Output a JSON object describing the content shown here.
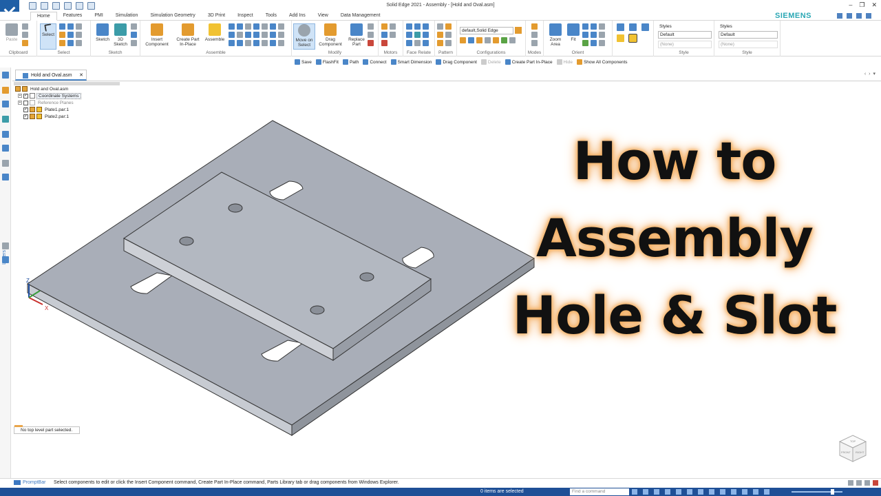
{
  "window": {
    "title": "Solid Edge 2021 - Assembly - [Hold and Oval.asm]",
    "controls": [
      "–",
      "❐",
      "✕"
    ]
  },
  "brand": "SIEMENS",
  "tabs": [
    "Home",
    "Features",
    "PMI",
    "Simulation",
    "Simulation Geometry",
    "3D Print",
    "Inspect",
    "Tools",
    "Add Ins",
    "View",
    "Data Management"
  ],
  "active_tab": "Home",
  "ribbon": {
    "clipboard": {
      "paste": "Paste",
      "label": "Clipboard"
    },
    "select": {
      "select": "Select",
      "label": "Select"
    },
    "sketch": {
      "sketch": "Sketch",
      "sketch3d": "3D Sketch",
      "label": "Sketch"
    },
    "assemble": {
      "insert": "Insert Component",
      "create": "Create Part In-Place",
      "assemble": "Assemble",
      "label": "Assemble"
    },
    "modify": {
      "move": "Move on Select",
      "drag": "Drag Component",
      "replace": "Replace Part",
      "label": "Modify"
    },
    "motors": {
      "label": "Motors"
    },
    "face_relate": {
      "label": "Face Relate"
    },
    "pattern": {
      "label": "Pattern"
    },
    "configurations": {
      "value": "default,Solid Edge",
      "label": "Configurations"
    },
    "modes": {
      "label": "Modes"
    },
    "orient": {
      "zoom": "Zoom Area",
      "fit": "Fit",
      "label": "Orient"
    },
    "style1": {
      "title": "Styles",
      "value": "Default",
      "sub": "(None)",
      "label": "Style"
    },
    "style2": {
      "title": "Styles",
      "value": "Default",
      "sub": "(None)",
      "label": "Style"
    }
  },
  "command_bar": [
    {
      "label": "Save",
      "enabled": true
    },
    {
      "label": "FlashFit",
      "enabled": true
    },
    {
      "label": "Path",
      "enabled": true
    },
    {
      "label": "Connect",
      "enabled": true
    },
    {
      "label": "Smart Dimension",
      "enabled": true
    },
    {
      "label": "Drag Component",
      "enabled": true
    },
    {
      "label": "Delete",
      "enabled": false
    },
    {
      "label": "Create Part In-Place",
      "enabled": true
    },
    {
      "label": "Hide",
      "enabled": false
    },
    {
      "label": "Show All Components",
      "enabled": true
    }
  ],
  "document_tab": {
    "label": "Hold and Oval.asm",
    "close": "✕"
  },
  "pathfinder": {
    "root": "Hold and Oval.asm",
    "items": [
      {
        "label": "Coordinate Systems",
        "checked": true
      },
      {
        "label": "Reference Planes",
        "checked": false
      },
      {
        "label": "Plate1.par:1",
        "checked": true
      },
      {
        "label": "Plate2.par:1",
        "checked": true
      }
    ]
  },
  "left_toolbar": {
    "layers": "Layers"
  },
  "status_message": "No top level part selected.",
  "prompt_bar": {
    "tab": "PromptBar",
    "text": "Select components to edit or click the Insert Component command, Create Part In-Place command, Parts Library tab or drag components from Windows Explorer."
  },
  "status_bar": {
    "items_selected": "0 items are selected",
    "find_placeholder": "Find a command"
  },
  "triad": {
    "z": "Z",
    "x": "X"
  },
  "viewcube": {
    "front": "FRONT",
    "right": "RIGHT",
    "top": "TOP"
  },
  "headline": [
    "How to",
    "Assembly",
    "Hole & Slot"
  ]
}
